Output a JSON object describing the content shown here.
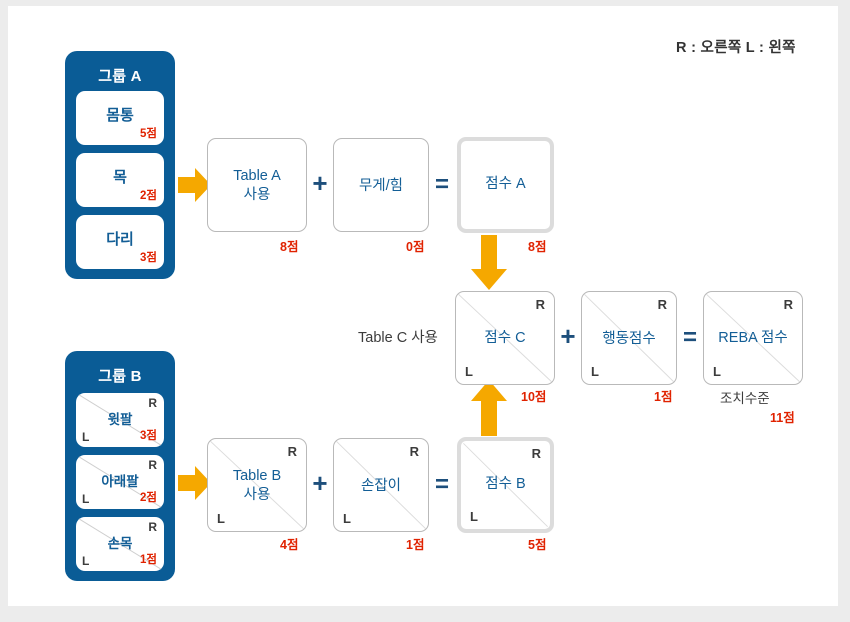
{
  "legend": {
    "text": "R : 오른쪽      L : 왼쪽",
    "right_key": "R",
    "right_value": "오른쪽",
    "left_key": "L",
    "left_value": "왼쪽"
  },
  "colors": {
    "group_panel": "#0a5c96",
    "box_text_blue": "#135e96",
    "score_red": "#e02200",
    "arrow_orange": "#f5a800",
    "operator_blue": "#1d4f7c",
    "thick_border_gray": "#dcdcdc",
    "thin_border_gray": "#b9b9b9"
  },
  "group_a": {
    "title": "그룹 A",
    "parts": [
      {
        "label": "몸통",
        "score": "5점"
      },
      {
        "label": "목",
        "score": "2점"
      },
      {
        "label": "다리",
        "score": "3점"
      }
    ]
  },
  "group_b": {
    "title": "그룹 B",
    "parts": [
      {
        "label": "윗팔",
        "score": "3점",
        "r": "R",
        "l": "L"
      },
      {
        "label": "아래팔",
        "score": "2점",
        "r": "R",
        "l": "L"
      },
      {
        "label": "손목",
        "score": "1점",
        "r": "R",
        "l": "L"
      }
    ]
  },
  "row_a": {
    "table_box": {
      "line1": "Table A",
      "line2": "사용",
      "score": "8점"
    },
    "op_plus": "+",
    "force_box": {
      "label": "무게/힘",
      "score": "0점"
    },
    "op_equals": "=",
    "score_box": {
      "label": "점수 A",
      "score": "8점"
    }
  },
  "row_b": {
    "table_box": {
      "line1": "Table B",
      "line2": "사용",
      "score": "4점",
      "r": "R",
      "l": "L"
    },
    "op_plus": "+",
    "coupling_box": {
      "label": "손잡이",
      "score": "1점",
      "r": "R",
      "l": "L"
    },
    "op_equals": "=",
    "score_box": {
      "label": "점수 B",
      "score": "5점",
      "r": "R",
      "l": "L"
    }
  },
  "row_c": {
    "table_c_label": "Table C 사용",
    "score_c_box": {
      "label": "점수 C",
      "score": "10점",
      "r": "R",
      "l": "L"
    },
    "op_plus": "+",
    "activity_box": {
      "label": "행동점수",
      "score": "1점",
      "r": "R",
      "l": "L"
    },
    "op_equals": "=",
    "reba_box": {
      "label": "REBA 점수",
      "r": "R",
      "l": "L"
    },
    "action_level": {
      "label": "조치수준",
      "score": "11점"
    }
  },
  "arrows": {
    "group_a_to_table_a": "arrow-right-icon",
    "group_b_to_table_b": "arrow-right-icon",
    "score_a_to_score_c": "arrow-down-icon",
    "score_b_to_score_c": "arrow-up-icon"
  }
}
